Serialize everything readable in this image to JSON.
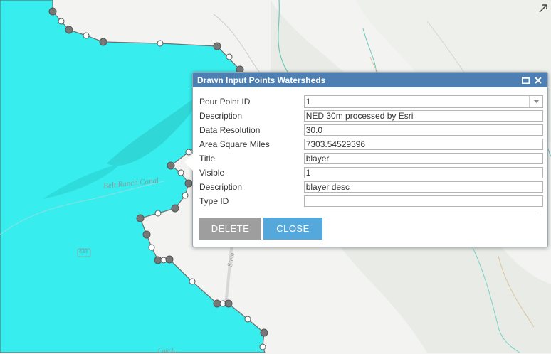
{
  "map": {
    "labels": {
      "canal": "Belt Ranch Canal",
      "route": "433",
      "road": "State",
      "bottom": "Couch..."
    },
    "colors": {
      "watershed": "#37eded",
      "boundary": "#6f6f6f",
      "basemap": "#f3f3f1"
    }
  },
  "popup": {
    "title": "Drawn Input Points Watersheds",
    "fields": [
      {
        "label": "Pour Point ID",
        "value": "1",
        "type": "select"
      },
      {
        "label": "Description",
        "value": "NED 30m processed by Esri"
      },
      {
        "label": "Data Resolution",
        "value": "30.0"
      },
      {
        "label": "Area Square Miles",
        "value": "7303.54529396"
      },
      {
        "label": "Title",
        "value": "blayer"
      },
      {
        "label": "Visible",
        "value": "1"
      },
      {
        "label": "Description",
        "value": "blayer desc"
      },
      {
        "label": "Type ID",
        "value": ""
      }
    ],
    "delete_label": "DELETE",
    "close_label": "CLOSE",
    "colors": {
      "header": "#4d7fb3",
      "delete": "#9e9e9e",
      "close": "#55a8db"
    }
  }
}
